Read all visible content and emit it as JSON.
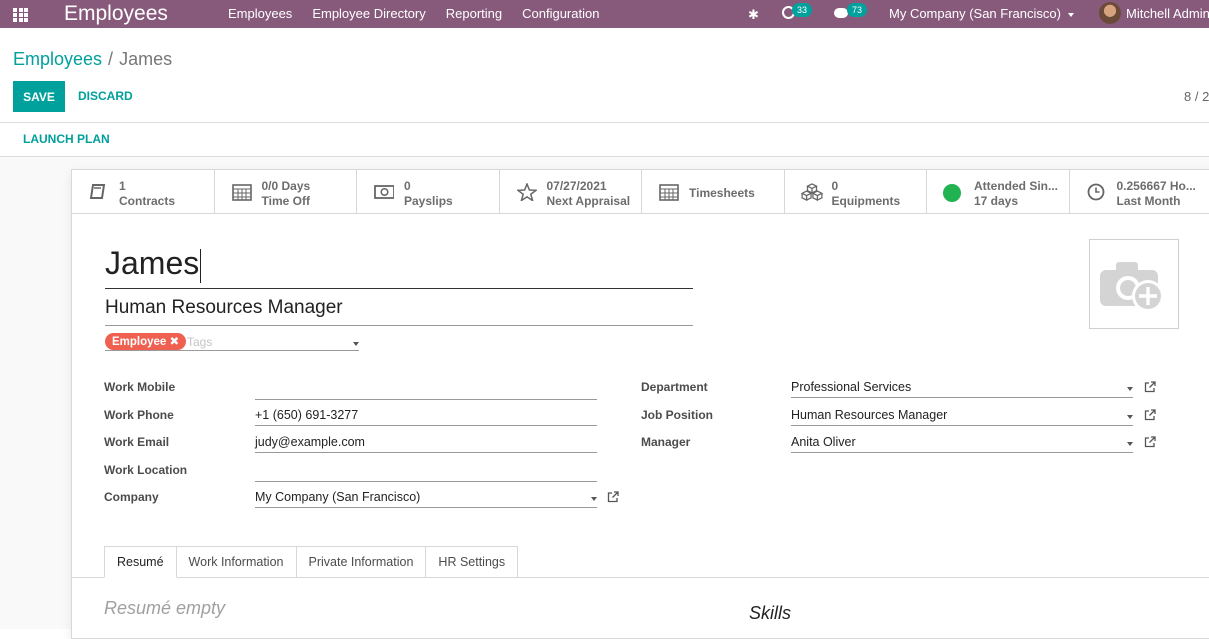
{
  "navbar": {
    "app_name": "Employees",
    "menu": [
      "Employees",
      "Employee Directory",
      "Reporting",
      "Configuration"
    ],
    "activity_count": "33",
    "messages_count": "73",
    "company": "My Company (San Francisco)",
    "user": "Mitchell Admin",
    "icons": [
      "apps-grid-icon",
      "bug-icon",
      "clock-icon",
      "chat-icon"
    ]
  },
  "breadcrumb": {
    "parent": "Employees",
    "separator": "/",
    "current": "James"
  },
  "actions": {
    "save": "SAVE",
    "discard": "DISCARD",
    "launch_plan": "LAUNCH PLAN"
  },
  "pager": "8 / 2",
  "smart_buttons": [
    {
      "value": "1",
      "label": "Contracts",
      "icon": "book-icon"
    },
    {
      "value": "0/0 Days",
      "label": "Time Off",
      "icon": "calendar-icon"
    },
    {
      "value": "0",
      "label": "Payslips",
      "icon": "money-icon"
    },
    {
      "value": "07/27/2021",
      "label": "Next Appraisal",
      "icon": "star-icon"
    },
    {
      "label": "Timesheets",
      "icon": "calendar-icon"
    },
    {
      "value": "0",
      "label": "Equipments",
      "icon": "cubes-icon"
    },
    {
      "value": "Attended Sin...",
      "label": "17 days",
      "icon": "presence-dot",
      "color": "#21b352"
    },
    {
      "value": "0.256667 Ho...",
      "label": "Last Month",
      "icon": "clock-icon"
    }
  ],
  "employee": {
    "name": "James",
    "job_title": "Human Resources Manager",
    "tag": "Employee",
    "tags_placeholder": "Tags"
  },
  "left_fields": [
    {
      "label": "Work Mobile",
      "value": ""
    },
    {
      "label": "Work Phone",
      "value": "+1 (650) 691-3277"
    },
    {
      "label": "Work Email",
      "value": "judy@example.com"
    },
    {
      "label": "Work Location",
      "value": ""
    },
    {
      "label": "Company",
      "value": "My Company (San Francisco)"
    }
  ],
  "right_fields": [
    {
      "label": "Department",
      "value": "Professional Services"
    },
    {
      "label": "Job Position",
      "value": "Human Resources Manager"
    },
    {
      "label": "Manager",
      "value": "Anita Oliver"
    }
  ],
  "tabs": [
    "Resumé",
    "Work Information",
    "Private Information",
    "HR Settings"
  ],
  "resume_empty": "Resumé empty",
  "skills_title": "Skills",
  "colors": {
    "brand": "#875a7b",
    "accent": "#00a09d",
    "tag": "#f06050",
    "presence": "#21b352"
  }
}
